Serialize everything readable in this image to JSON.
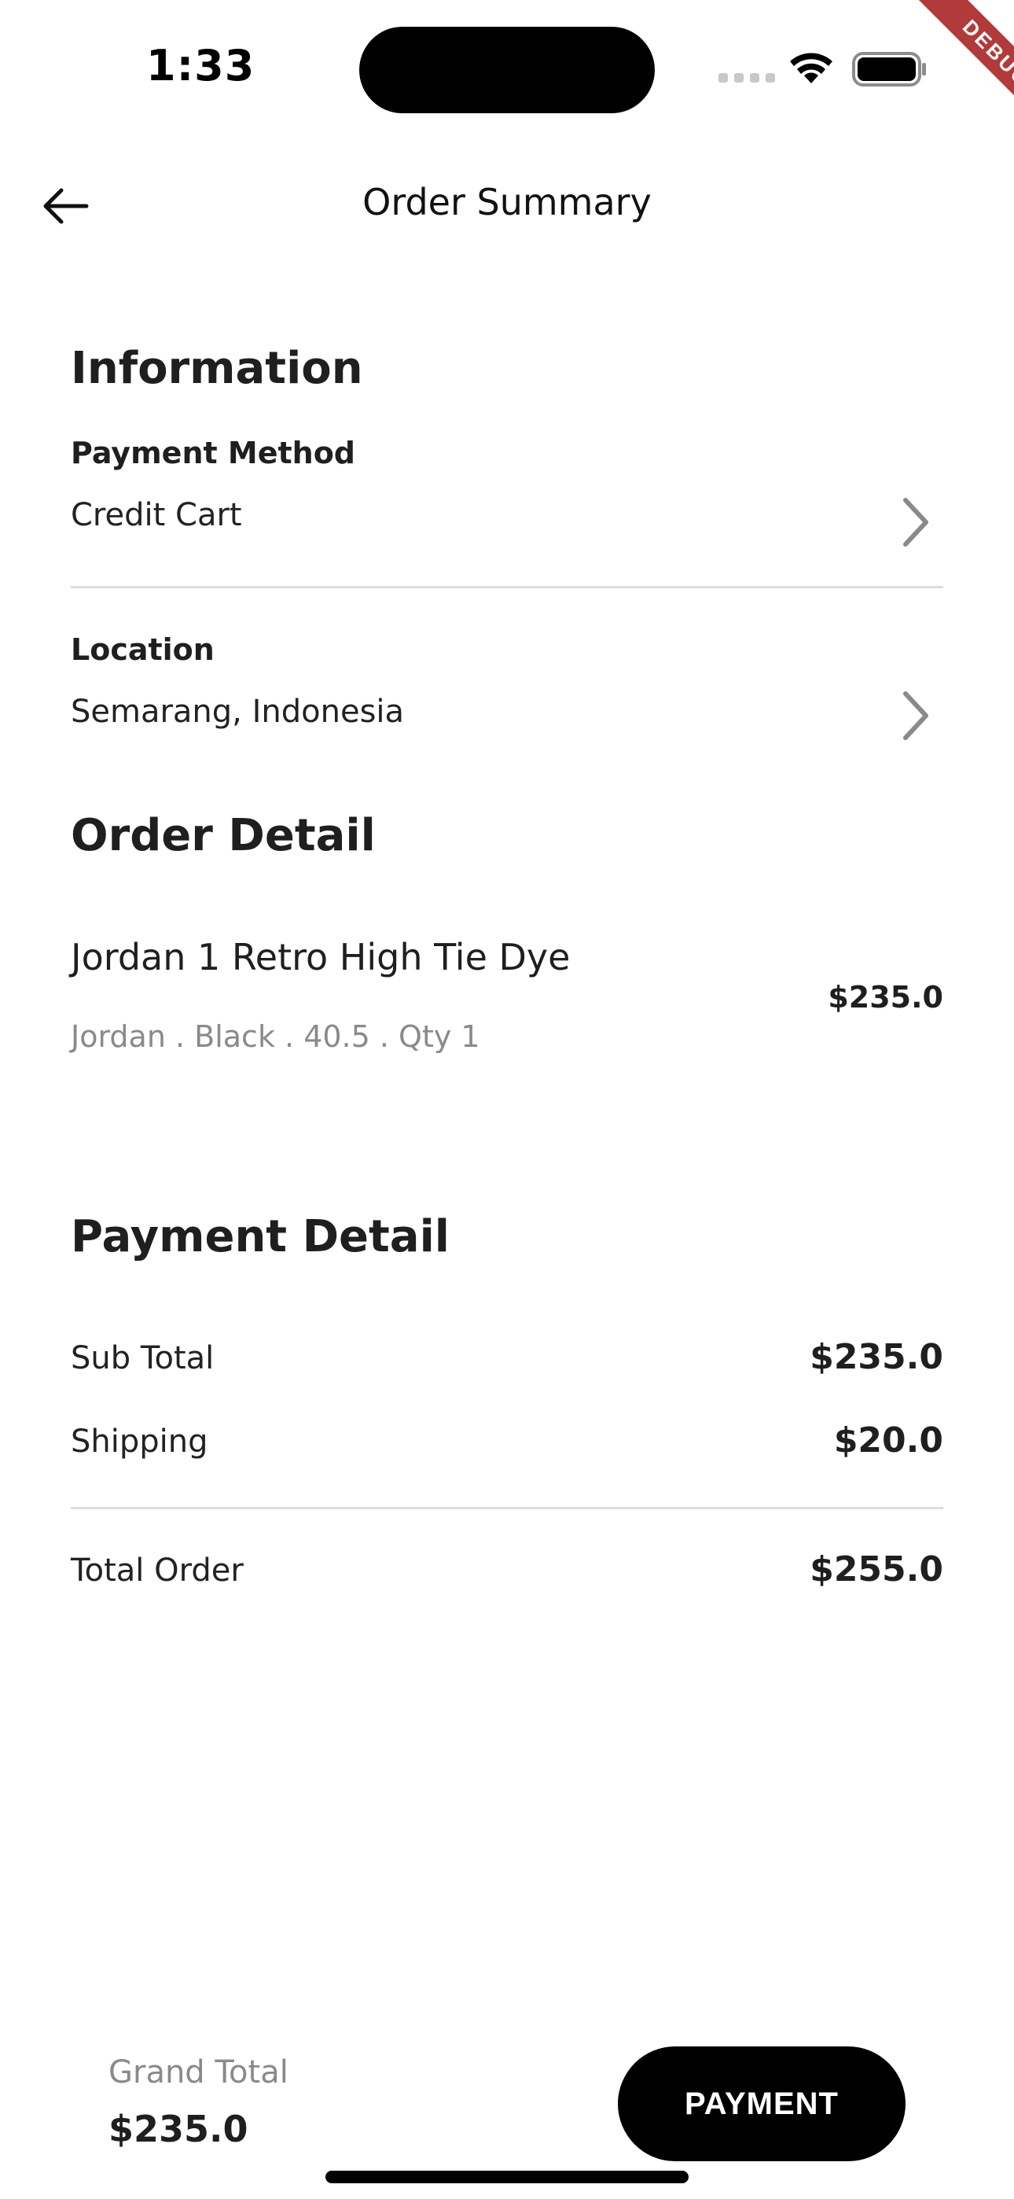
{
  "status_bar": {
    "time": "1:33"
  },
  "debug_banner": "DEBUG",
  "app_bar": {
    "title": "Order Summary",
    "back_icon": "arrow-left-icon"
  },
  "information": {
    "title": "Information",
    "payment_method": {
      "label": "Payment Method",
      "value": "Credit Cart"
    },
    "location": {
      "label": "Location",
      "value": "Semarang, Indonesia"
    }
  },
  "order_detail": {
    "title": "Order Detail",
    "items": [
      {
        "name": "Jordan 1 Retro High Tie Dye",
        "meta": "Jordan . Black . 40.5 . Qty 1",
        "price": "$235.0"
      }
    ]
  },
  "payment_detail": {
    "title": "Payment Detail",
    "sub_total_label": "Sub Total",
    "sub_total_value": "$235.0",
    "shipping_label": "Shipping",
    "shipping_value": "$20.0",
    "total_label": "Total Order",
    "total_value": "$255.0"
  },
  "bottom_bar": {
    "grand_total_label": "Grand Total",
    "grand_total_value": "$235.0",
    "payment_button": "PAYMENT"
  },
  "colors": {
    "primary": "#000000",
    "text": "#1f1f1f",
    "muted": "#8a8a8a",
    "divider": "#dcdcdc",
    "debug": "#b33a3a"
  }
}
